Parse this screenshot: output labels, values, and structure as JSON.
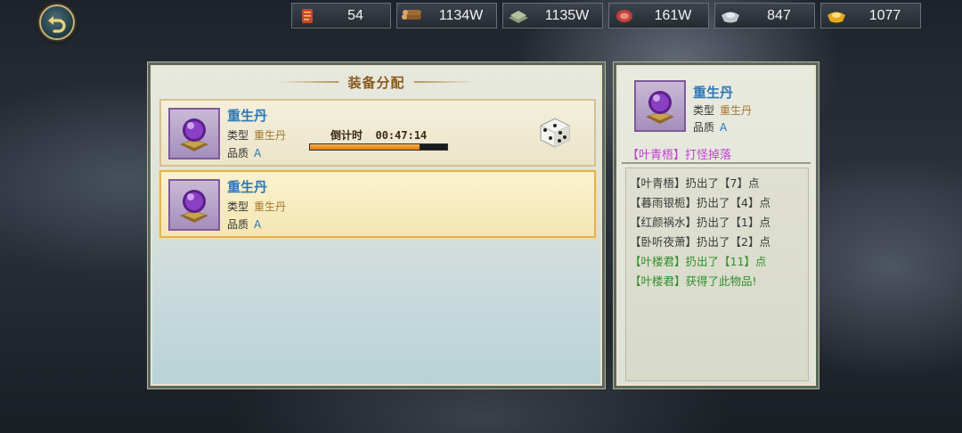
{
  "resources": [
    {
      "icon": "scroll-icon",
      "value": "54"
    },
    {
      "icon": "wood-icon",
      "value": "1134W"
    },
    {
      "icon": "stone-icon",
      "value": "1135W"
    },
    {
      "icon": "meat-icon",
      "value": "161W"
    },
    {
      "icon": "silver-icon",
      "value": "847"
    },
    {
      "icon": "gold-ingot-icon",
      "value": "1077"
    }
  ],
  "allocation_panel": {
    "title": "装备分配",
    "items": [
      {
        "name": "重生丹",
        "type_label": "类型",
        "type_value": "重生丹",
        "quality_label": "品质",
        "quality_value": "A",
        "countdown_label": "倒计时",
        "countdown_value": "00:47:14",
        "progress": 0.8
      },
      {
        "name": "重生丹",
        "type_label": "类型",
        "type_value": "重生丹",
        "quality_label": "品质",
        "quality_value": "A"
      }
    ]
  },
  "detail_panel": {
    "name": "重生丹",
    "type_label": "类型",
    "type_value": "重生丹",
    "quality_label": "品质",
    "quality_value": "A",
    "drop_source": "【叶青梧】打怪掉落",
    "log": [
      "【叶青梧】扔出了【7】点",
      "【暮雨银栀】扔出了【4】点",
      "【红颜祸水】扔出了【1】点",
      "【卧听夜萧】扔出了【2】点",
      "【叶楼君】扔出了【11】点",
      "【叶楼君】获得了此物品!"
    ]
  },
  "colors": {
    "item_name": "#2d77b5",
    "type_value": "#a0782e",
    "drop_source": "#c23fd0",
    "log_highlight": "#2f8e2a",
    "progress_fill": "#f0961e"
  }
}
